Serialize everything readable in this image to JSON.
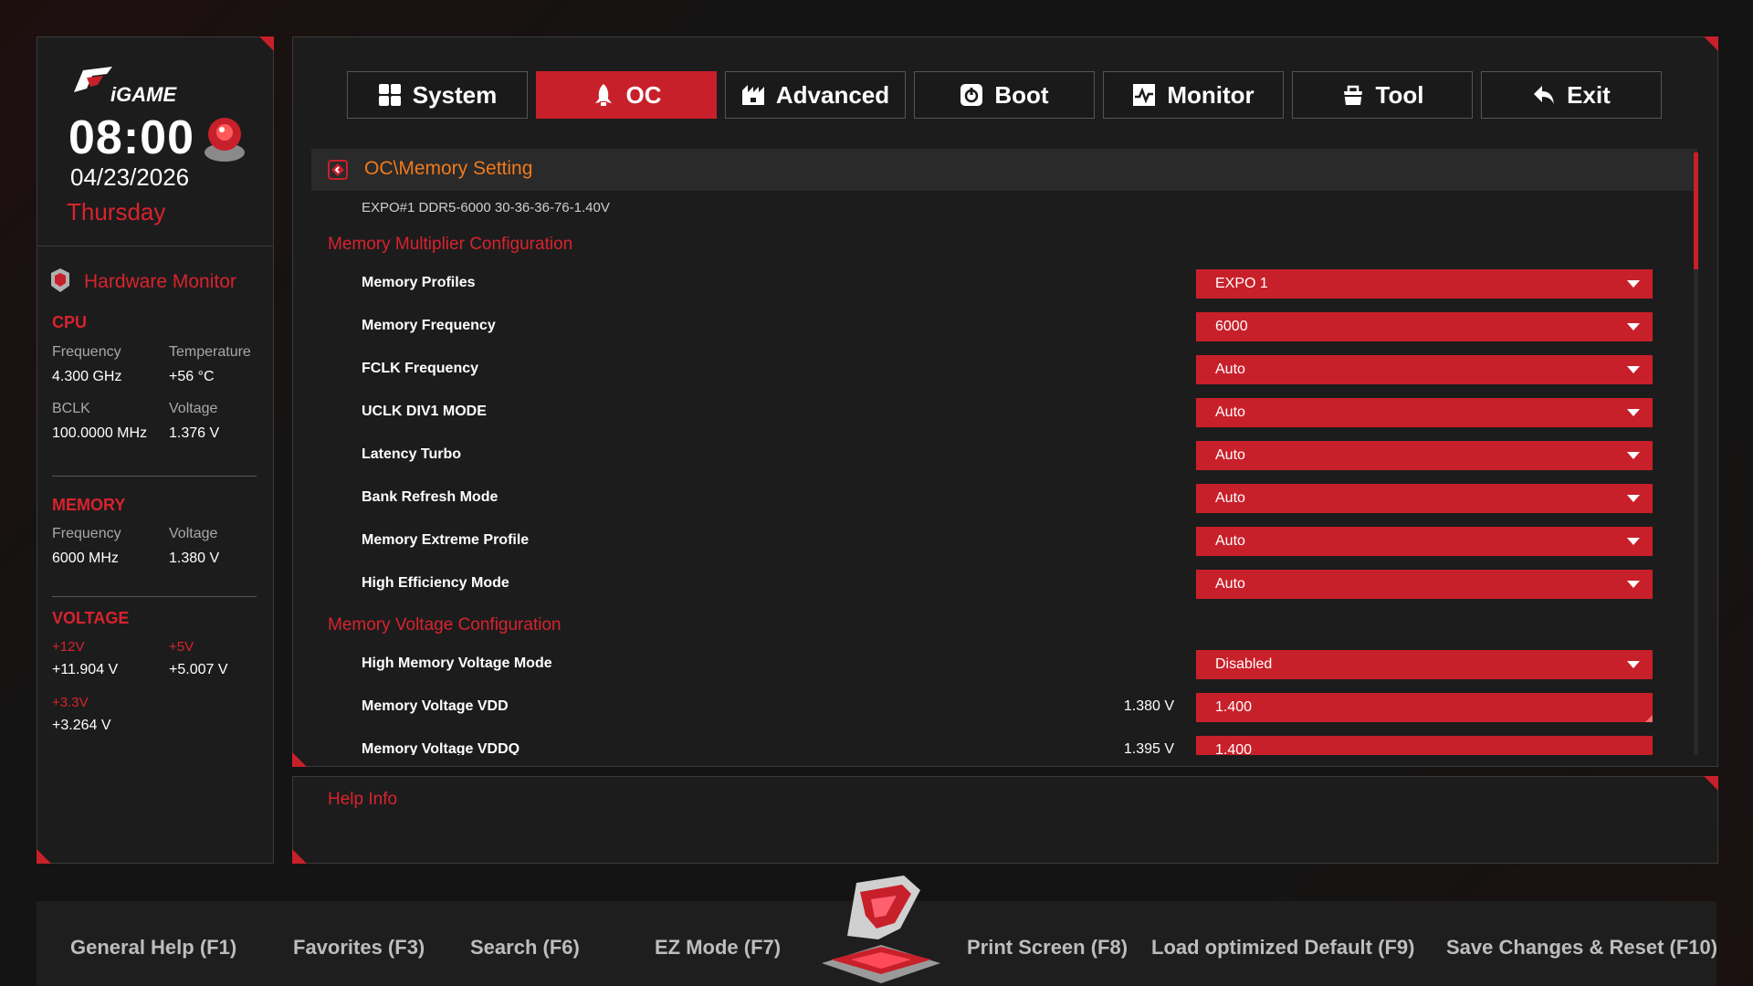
{
  "sidebar": {
    "time": "08:00",
    "date": "04/23/2026",
    "day": "Thursday",
    "hw_title": "Hardware Monitor",
    "cpu": {
      "title": "CPU",
      "freq_label": "Frequency",
      "freq": "4.300 GHz",
      "temp_label": "Temperature",
      "temp": "+56 °C",
      "bclk_label": "BCLK",
      "bclk": "100.0000 MHz",
      "volt_label": "Voltage",
      "volt": "1.376 V"
    },
    "memory": {
      "title": "MEMORY",
      "freq_label": "Frequency",
      "freq": "6000 MHz",
      "volt_label": "Voltage",
      "volt": "1.380 V"
    },
    "voltage": {
      "title": "VOLTAGE",
      "v12_label": "+12V",
      "v12": "+11.904 V",
      "v5_label": "+5V",
      "v5": "+5.007 V",
      "v33_label": "+3.3V",
      "v33": "+3.264 V"
    }
  },
  "tabs": [
    "System",
    "OC",
    "Advanced",
    "Boot",
    "Monitor",
    "Tool",
    "Exit"
  ],
  "active_tab": "OC",
  "main": {
    "breadcrumb": "OC\\Memory Setting",
    "expo_info": "EXPO#1 DDR5-6000 30-36-36-76-1.40V",
    "group1": "Memory Multiplier Configuration",
    "group2": "Memory Voltage Configuration",
    "rows": [
      {
        "label": "Memory Profiles",
        "value": "EXPO 1"
      },
      {
        "label": "Memory Frequency",
        "value": "6000"
      },
      {
        "label": "FCLK Frequency",
        "value": "Auto"
      },
      {
        "label": "UCLK DIV1 MODE",
        "value": "Auto"
      },
      {
        "label": "Latency Turbo",
        "value": "Auto"
      },
      {
        "label": "Bank Refresh Mode",
        "value": "Auto"
      },
      {
        "label": "Memory Extreme Profile",
        "value": "Auto"
      },
      {
        "label": "High Efficiency Mode",
        "value": "Auto"
      }
    ],
    "vrows": [
      {
        "label": "High Memory Voltage Mode",
        "current": "",
        "value": "Disabled"
      },
      {
        "label": "Memory Voltage VDD",
        "current": "1.380 V",
        "value": "1.400"
      },
      {
        "label": "Memory Voltage VDDQ",
        "current": "1.395 V",
        "value": "1.400"
      }
    ]
  },
  "help": {
    "title": "Help Info"
  },
  "bottom": {
    "f1": "General Help (F1)",
    "f3": "Favorites (F3)",
    "f6": "Search (F6)",
    "f7": "EZ Mode (F7)",
    "f8": "Print Screen (F8)",
    "f9": "Load optimized Default (F9)",
    "f10": "Save Changes & Reset (F10)"
  },
  "colors": {
    "accent": "#c8202a",
    "breadcrumb": "#f07a1c",
    "bg": "#141414"
  }
}
